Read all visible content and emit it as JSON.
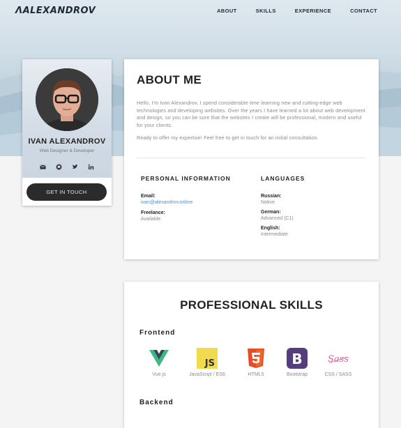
{
  "header": {
    "logo": "ALEXANDROV",
    "nav": [
      "ABOUT",
      "SKILLS",
      "EXPERIENCE",
      "CONTACT"
    ]
  },
  "profile": {
    "name": "IVAN ALEXANDROV",
    "role": "Web Designer & Developer",
    "socials": [
      "envelope-icon",
      "github-icon",
      "twitter-icon",
      "linkedin-icon"
    ],
    "button": "GET IN TOUCH"
  },
  "about": {
    "title": "ABOUT ME",
    "paragraph1": "Hello, I'm Ivan Alexandrov. I spend considerable time learning new and cutting-edge web technologies and developing websites. Over the years I have learned a lot about web development and design, so you can be sure that the websites I create will be professional, modern and useful for your clients.",
    "paragraph2": "Ready to offer my expertise! Feel free to get in touch for an initial consultation.",
    "personal": {
      "title": "PERSONAL  INFORMATION",
      "email_label": "Email:",
      "email_value": "ivan@alexandrov.online",
      "freelance_label": "Freelance:",
      "freelance_value": "Available"
    },
    "languages": {
      "title": "LANGUAGES",
      "items": [
        {
          "label": "Russian:",
          "value": "Native"
        },
        {
          "label": "German:",
          "value": "Advanced (C1)"
        },
        {
          "label": "English:",
          "value": "Intermediate"
        }
      ]
    }
  },
  "skills": {
    "title": "PROFESSIONAL SKILLS",
    "frontend_label": "Frontend",
    "frontend": [
      {
        "name": "Vue.js",
        "icon": "vue-icon",
        "color": "#41b883"
      },
      {
        "name": "JavaScript / ES6",
        "icon": "javascript-icon",
        "color": "#f0db4f"
      },
      {
        "name": "HTML5",
        "icon": "html5-icon",
        "color": "#e44d26"
      },
      {
        "name": "Bootstrap",
        "icon": "bootstrap-icon",
        "color": "#563d7c"
      },
      {
        "name": "CSS / SASS",
        "icon": "sass-icon",
        "color": "#cd6799"
      }
    ],
    "backend_label": "Backend"
  }
}
